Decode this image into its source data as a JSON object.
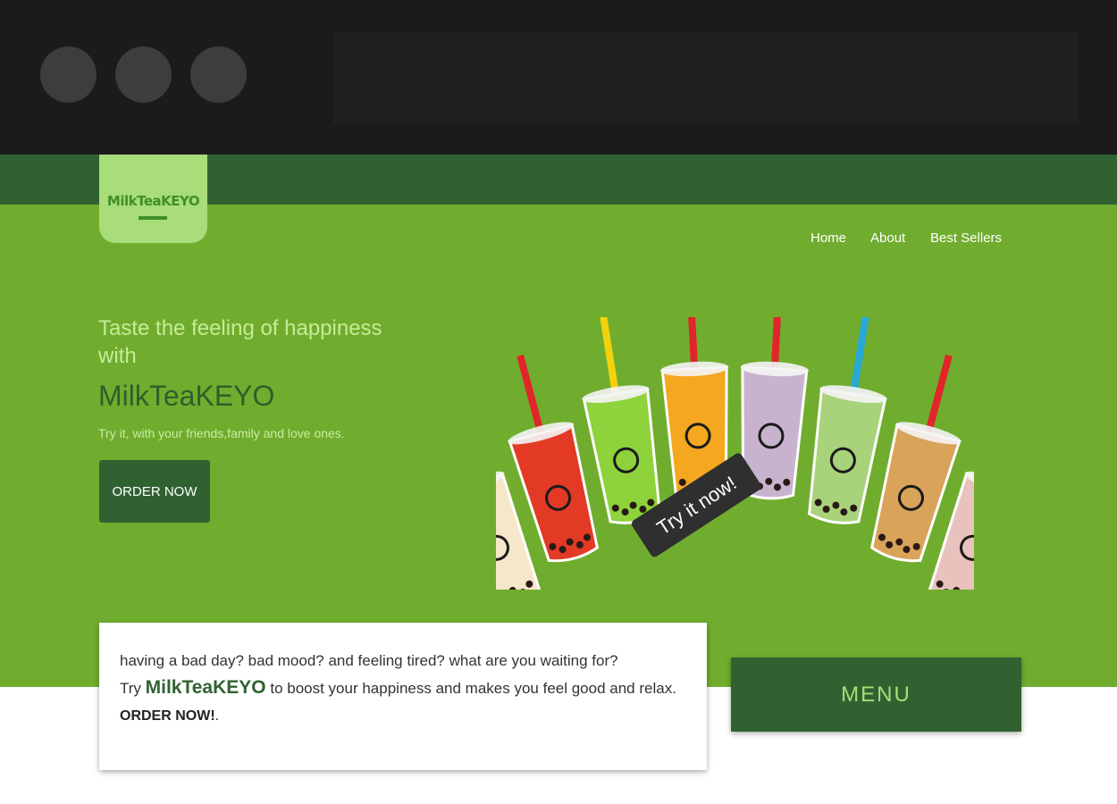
{
  "browser": {
    "window_controls": [
      "window-dot",
      "window-dot",
      "window-dot"
    ]
  },
  "header": {
    "logo": "MilkTeaKEYO",
    "nav": [
      {
        "label": "Home"
      },
      {
        "label": "About"
      },
      {
        "label": "Best Sellers"
      }
    ]
  },
  "hero": {
    "tagline": "Taste the feeling of happiness with",
    "brand": "MilkTeaKEYO",
    "subtitle": "Try it, with your friends,family and love ones.",
    "order_button": "ORDER NOW",
    "image_badge": "Try it now!",
    "cups": [
      {
        "liquid": "#f6e7c8",
        "straw": "#e0262a"
      },
      {
        "liquid": "#e23a24",
        "straw": "#e0262a"
      },
      {
        "liquid": "#8ed23c",
        "straw": "#f2d20c"
      },
      {
        "liquid": "#f4a71f",
        "straw": "#e0262a"
      },
      {
        "liquid": "#c8b3cf",
        "straw": "#e0262a"
      },
      {
        "liquid": "#a9d37a",
        "straw": "#27a8d6"
      },
      {
        "liquid": "#d9a35a",
        "straw": "#e0262a"
      },
      {
        "liquid": "#e8c3bd",
        "straw": "#e0262a"
      }
    ]
  },
  "info": {
    "line1": "having a bad day? bad mood? and feeling tired? what are you waiting for?",
    "line2_prefix": "Try ",
    "line2_brand": "MilkTeaKEYO",
    "line2_suffix": " to boost your happiness and makes you feel good and relax.",
    "line3_bold": "ORDER NOW!",
    "line3_end": "."
  },
  "menu_button": "MENU",
  "colors": {
    "dark_green": "#306231",
    "light_green": "#70ad2e",
    "pale_green": "#a8dd79"
  }
}
